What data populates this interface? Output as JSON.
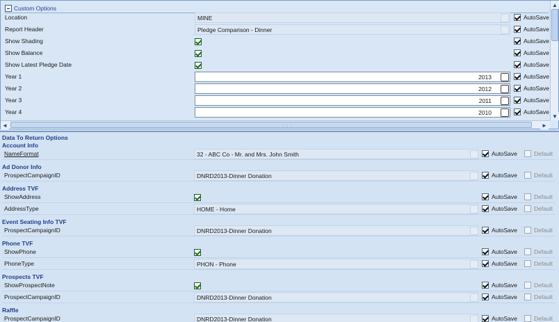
{
  "custom_options": {
    "header": "Custom Options",
    "rows": [
      {
        "label": "Location",
        "type": "text",
        "value": "MINE",
        "autosave": true
      },
      {
        "label": "Report Header",
        "type": "text",
        "value": "Pledge Comparison - Dinner",
        "autosave": true
      },
      {
        "label": "Show Shading",
        "type": "check",
        "checked": true,
        "autosave": true
      },
      {
        "label": "Show Balance",
        "type": "check",
        "checked": true,
        "autosave": true
      },
      {
        "label": "Show Latest Pledge Date",
        "type": "check",
        "checked": true,
        "autosave": true
      },
      {
        "label": "Year 1",
        "type": "number",
        "value": "2013",
        "autosave": true
      },
      {
        "label": "Year 2",
        "type": "number",
        "value": "2012",
        "autosave": true
      },
      {
        "label": "Year 3",
        "type": "number",
        "value": "2011",
        "autosave": true
      },
      {
        "label": "Year 4",
        "type": "number",
        "value": "2010",
        "autosave": true
      }
    ],
    "autosave_label": "AutoSave"
  },
  "data_to_return": {
    "header": "Data To Return Options",
    "autosave_label": "AutoSave",
    "default_label": "Default",
    "sections": [
      {
        "title": "Account Info",
        "rows": [
          {
            "label": "NameFormat",
            "type": "text",
            "value": "32 - ABC Co - Mr. and Mrs. John Smith",
            "autosave": true,
            "default": false,
            "underline": true
          }
        ]
      },
      {
        "title": "Ad Donor Info",
        "rows": [
          {
            "label": "ProspectCampaignID",
            "type": "text",
            "value": "DNRD2013-Dinner Donation",
            "autosave": true,
            "default": false
          }
        ]
      },
      {
        "title": "Address TVF",
        "rows": [
          {
            "label": "ShowAddress",
            "type": "check",
            "checked": true,
            "autosave": true,
            "default": false
          },
          {
            "label": "AddressType",
            "type": "text",
            "value": "HOME - Home",
            "autosave": true,
            "default": false
          }
        ]
      },
      {
        "title": "Event Seating Info TVF",
        "rows": [
          {
            "label": "ProspectCampaignID",
            "type": "text",
            "value": "DNRD2013-Dinner Donation",
            "autosave": true,
            "default": false
          }
        ]
      },
      {
        "title": "Phone TVF",
        "rows": [
          {
            "label": "ShowPhone",
            "type": "check",
            "checked": true,
            "autosave": true,
            "default": false
          },
          {
            "label": "PhoneType",
            "type": "text",
            "value": "PHON - Phone",
            "autosave": true,
            "default": false
          }
        ]
      },
      {
        "title": "Prospects TVF",
        "rows": [
          {
            "label": "ShowProspectNote",
            "type": "check",
            "checked": true,
            "autosave": true,
            "default": false
          },
          {
            "label": "ProspectCampaignID",
            "type": "text",
            "value": "DNRD2013-Dinner Donation",
            "autosave": true,
            "default": false
          }
        ]
      },
      {
        "title": "Raffle",
        "rows": [
          {
            "label": "ProspectCampaignID",
            "type": "text",
            "value": "DNRD2013-Dinner Donation",
            "autosave": true,
            "default": false
          }
        ]
      }
    ]
  },
  "icons": {
    "scroll_up": "▲",
    "scroll_down": "▼",
    "scroll_left": "◄",
    "scroll_right": "►",
    "grip": "⋮⋮⋮"
  }
}
